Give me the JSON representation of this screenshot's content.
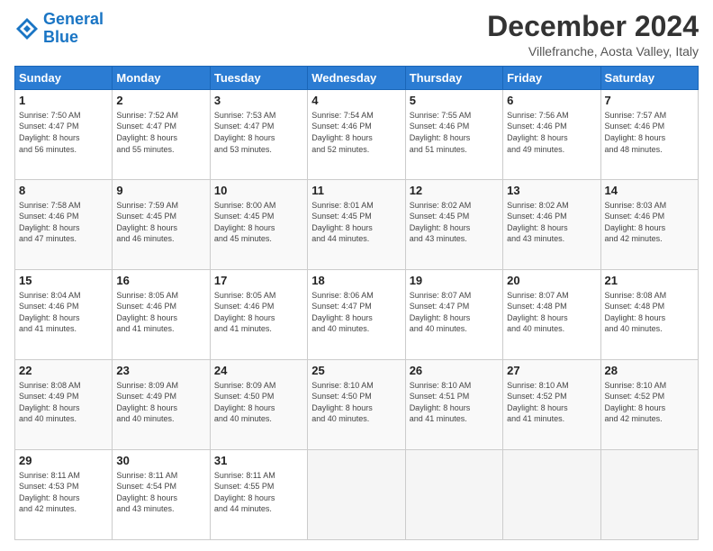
{
  "header": {
    "logo_line1": "General",
    "logo_line2": "Blue",
    "month_title": "December 2024",
    "location": "Villefranche, Aosta Valley, Italy"
  },
  "days_of_week": [
    "Sunday",
    "Monday",
    "Tuesday",
    "Wednesday",
    "Thursday",
    "Friday",
    "Saturday"
  ],
  "weeks": [
    [
      {
        "day": "1",
        "info": "Sunrise: 7:50 AM\nSunset: 4:47 PM\nDaylight: 8 hours\nand 56 minutes."
      },
      {
        "day": "2",
        "info": "Sunrise: 7:52 AM\nSunset: 4:47 PM\nDaylight: 8 hours\nand 55 minutes."
      },
      {
        "day": "3",
        "info": "Sunrise: 7:53 AM\nSunset: 4:47 PM\nDaylight: 8 hours\nand 53 minutes."
      },
      {
        "day": "4",
        "info": "Sunrise: 7:54 AM\nSunset: 4:46 PM\nDaylight: 8 hours\nand 52 minutes."
      },
      {
        "day": "5",
        "info": "Sunrise: 7:55 AM\nSunset: 4:46 PM\nDaylight: 8 hours\nand 51 minutes."
      },
      {
        "day": "6",
        "info": "Sunrise: 7:56 AM\nSunset: 4:46 PM\nDaylight: 8 hours\nand 49 minutes."
      },
      {
        "day": "7",
        "info": "Sunrise: 7:57 AM\nSunset: 4:46 PM\nDaylight: 8 hours\nand 48 minutes."
      }
    ],
    [
      {
        "day": "8",
        "info": "Sunrise: 7:58 AM\nSunset: 4:46 PM\nDaylight: 8 hours\nand 47 minutes."
      },
      {
        "day": "9",
        "info": "Sunrise: 7:59 AM\nSunset: 4:45 PM\nDaylight: 8 hours\nand 46 minutes."
      },
      {
        "day": "10",
        "info": "Sunrise: 8:00 AM\nSunset: 4:45 PM\nDaylight: 8 hours\nand 45 minutes."
      },
      {
        "day": "11",
        "info": "Sunrise: 8:01 AM\nSunset: 4:45 PM\nDaylight: 8 hours\nand 44 minutes."
      },
      {
        "day": "12",
        "info": "Sunrise: 8:02 AM\nSunset: 4:45 PM\nDaylight: 8 hours\nand 43 minutes."
      },
      {
        "day": "13",
        "info": "Sunrise: 8:02 AM\nSunset: 4:46 PM\nDaylight: 8 hours\nand 43 minutes."
      },
      {
        "day": "14",
        "info": "Sunrise: 8:03 AM\nSunset: 4:46 PM\nDaylight: 8 hours\nand 42 minutes."
      }
    ],
    [
      {
        "day": "15",
        "info": "Sunrise: 8:04 AM\nSunset: 4:46 PM\nDaylight: 8 hours\nand 41 minutes."
      },
      {
        "day": "16",
        "info": "Sunrise: 8:05 AM\nSunset: 4:46 PM\nDaylight: 8 hours\nand 41 minutes."
      },
      {
        "day": "17",
        "info": "Sunrise: 8:05 AM\nSunset: 4:46 PM\nDaylight: 8 hours\nand 41 minutes."
      },
      {
        "day": "18",
        "info": "Sunrise: 8:06 AM\nSunset: 4:47 PM\nDaylight: 8 hours\nand 40 minutes."
      },
      {
        "day": "19",
        "info": "Sunrise: 8:07 AM\nSunset: 4:47 PM\nDaylight: 8 hours\nand 40 minutes."
      },
      {
        "day": "20",
        "info": "Sunrise: 8:07 AM\nSunset: 4:48 PM\nDaylight: 8 hours\nand 40 minutes."
      },
      {
        "day": "21",
        "info": "Sunrise: 8:08 AM\nSunset: 4:48 PM\nDaylight: 8 hours\nand 40 minutes."
      }
    ],
    [
      {
        "day": "22",
        "info": "Sunrise: 8:08 AM\nSunset: 4:49 PM\nDaylight: 8 hours\nand 40 minutes."
      },
      {
        "day": "23",
        "info": "Sunrise: 8:09 AM\nSunset: 4:49 PM\nDaylight: 8 hours\nand 40 minutes."
      },
      {
        "day": "24",
        "info": "Sunrise: 8:09 AM\nSunset: 4:50 PM\nDaylight: 8 hours\nand 40 minutes."
      },
      {
        "day": "25",
        "info": "Sunrise: 8:10 AM\nSunset: 4:50 PM\nDaylight: 8 hours\nand 40 minutes."
      },
      {
        "day": "26",
        "info": "Sunrise: 8:10 AM\nSunset: 4:51 PM\nDaylight: 8 hours\nand 41 minutes."
      },
      {
        "day": "27",
        "info": "Sunrise: 8:10 AM\nSunset: 4:52 PM\nDaylight: 8 hours\nand 41 minutes."
      },
      {
        "day": "28",
        "info": "Sunrise: 8:10 AM\nSunset: 4:52 PM\nDaylight: 8 hours\nand 42 minutes."
      }
    ],
    [
      {
        "day": "29",
        "info": "Sunrise: 8:11 AM\nSunset: 4:53 PM\nDaylight: 8 hours\nand 42 minutes."
      },
      {
        "day": "30",
        "info": "Sunrise: 8:11 AM\nSunset: 4:54 PM\nDaylight: 8 hours\nand 43 minutes."
      },
      {
        "day": "31",
        "info": "Sunrise: 8:11 AM\nSunset: 4:55 PM\nDaylight: 8 hours\nand 44 minutes."
      },
      {
        "day": "",
        "info": ""
      },
      {
        "day": "",
        "info": ""
      },
      {
        "day": "",
        "info": ""
      },
      {
        "day": "",
        "info": ""
      }
    ]
  ]
}
